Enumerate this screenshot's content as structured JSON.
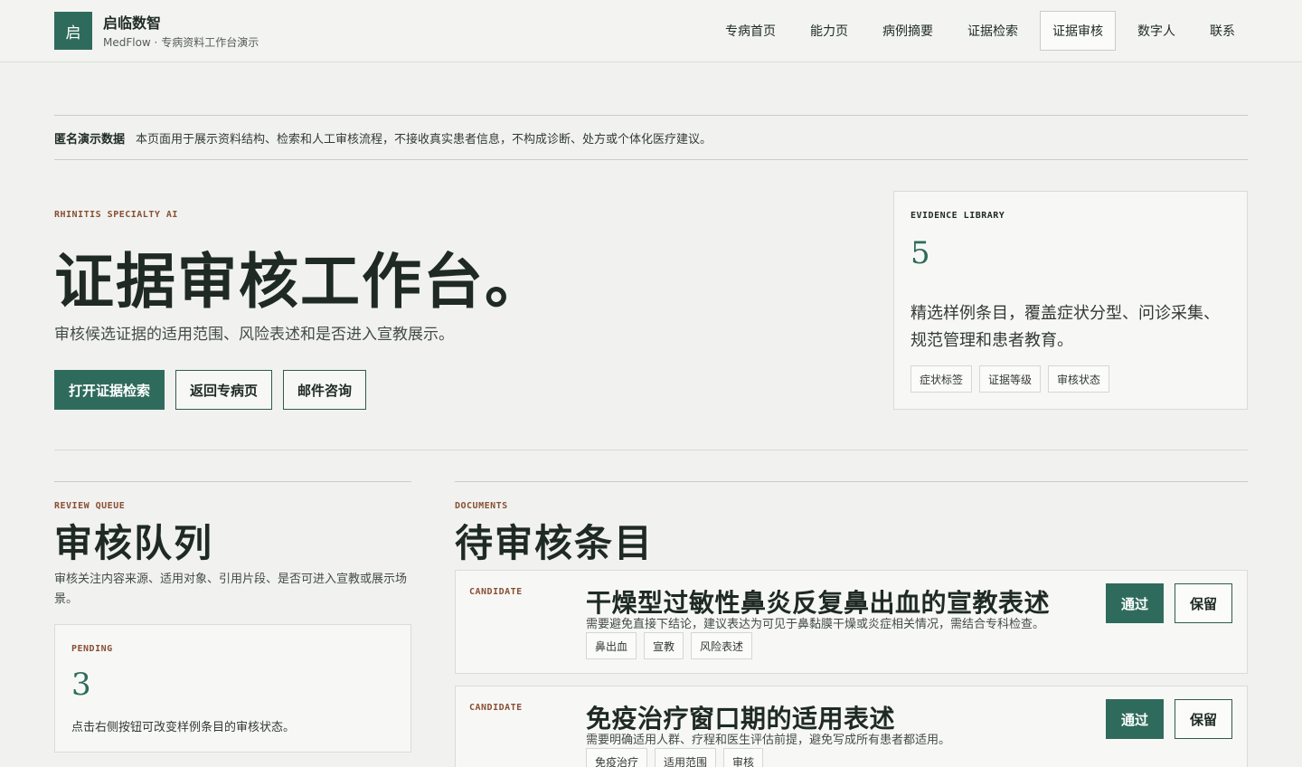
{
  "brand": {
    "logo_char": "启",
    "name": "启临数智",
    "subtitle": "MedFlow · 专病资料工作台演示"
  },
  "nav": {
    "items": [
      "专病首页",
      "能力页",
      "病例摘要",
      "证据检索",
      "证据审核",
      "数字人",
      "联系"
    ],
    "active": "证据审核"
  },
  "notice": {
    "label": "匿名演示数据",
    "text": "本页面用于展示资料结构、检索和人工审核流程，不接收真实患者信息，不构成诊断、处方或个体化医疗建议。"
  },
  "hero": {
    "kicker": "RHINITIS SPECIALTY AI",
    "title": "证据审核工作台。",
    "subtitle": "审核候选证据的适用范围、风险表述和是否进入宣教展示。",
    "buttons": {
      "search": "打开证据检索",
      "back": "返回专病页",
      "email": "邮件咨询"
    }
  },
  "library": {
    "kicker": "EVIDENCE LIBRARY",
    "count": "5",
    "description": "精选样例条目，覆盖症状分型、问诊采集、规范管理和患者教育。",
    "chips": [
      "症状标签",
      "证据等级",
      "审核状态"
    ]
  },
  "queue": {
    "kicker": "REVIEW QUEUE",
    "title": "审核队列",
    "description": "审核关注内容来源、适用对象、引用片段、是否可进入宣教或展示场景。",
    "pending": {
      "kicker": "PENDING",
      "count": "3",
      "description": "点击右侧按钮可改变样例条目的审核状态。"
    }
  },
  "documents": {
    "kicker": "DOCUMENTS",
    "title": "待审核条目",
    "items": [
      {
        "status": "CANDIDATE",
        "title": "干燥型过敏性鼻炎反复鼻出血的宣教表述",
        "description": "需要避免直接下结论，建议表达为可见于鼻黏膜干燥或炎症相关情况，需结合专科检查。",
        "tags": [
          "鼻出血",
          "宣教",
          "风险表述"
        ],
        "pass_label": "通过",
        "keep_label": "保留"
      },
      {
        "status": "CANDIDATE",
        "title": "免疫治疗窗口期的适用表述",
        "description": "需要明确适用人群、疗程和医生评估前提，避免写成所有患者都适用。",
        "tags": [
          "免疫治疗",
          "适用范围",
          "审核"
        ],
        "pass_label": "通过",
        "keep_label": "保留"
      }
    ]
  },
  "colors": {
    "accent": "#2f6b5c",
    "kicker": "#8a4e34",
    "background": "#f1f2ef"
  }
}
